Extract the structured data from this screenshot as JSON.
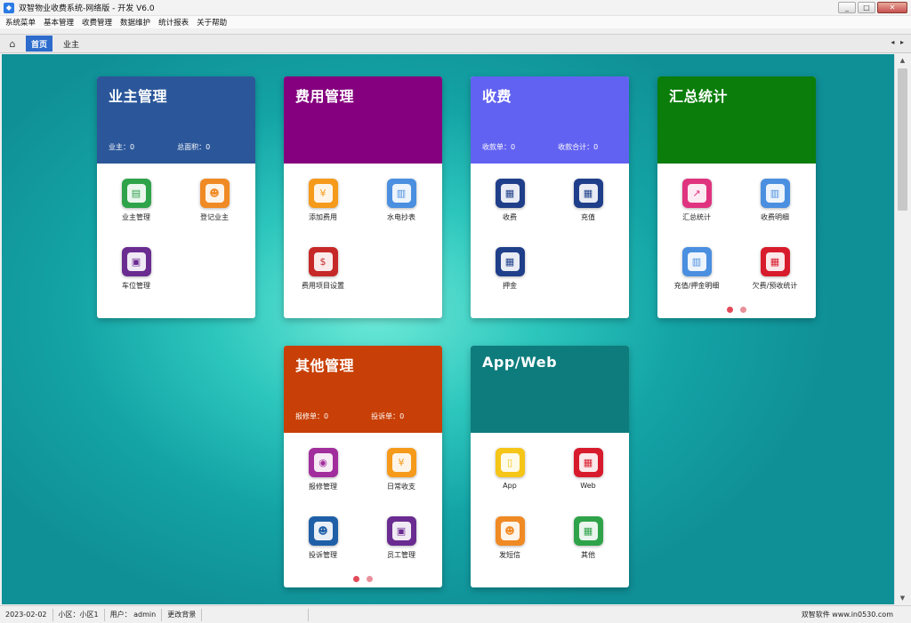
{
  "window": {
    "title": "双智物业收费系统-网络版 - 开发  V6.0",
    "minimize": "_",
    "maximize": "□",
    "close": "✕",
    "accent": "#2d6bcc"
  },
  "menu": [
    "系统菜单",
    "基本管理",
    "收费管理",
    "数据维护",
    "统计报表",
    "关于帮助"
  ],
  "tabs": {
    "home_icon": "⌂",
    "items": [
      "首页",
      "业主"
    ],
    "arrows": "◂ ▸"
  },
  "cards": {
    "owner": {
      "title": "业主管理",
      "color": "#2b579a",
      "stats": [
        "业主：0",
        "总面积：0"
      ],
      "tiles": [
        {
          "label": "业主管理",
          "icon": "owner-list-icon",
          "color": "#2fa34a",
          "glyph": "▤"
        },
        {
          "label": "登记业主",
          "icon": "register-owner-icon",
          "color": "#f08a24",
          "glyph": "☻"
        },
        {
          "label": "车位管理",
          "icon": "parking-icon",
          "color": "#6a2c91",
          "glyph": "▣"
        }
      ]
    },
    "fee": {
      "title": "费用管理",
      "color": "#85007e",
      "stats": [],
      "tiles": [
        {
          "label": "添加费用",
          "icon": "add-fee-icon",
          "color": "#f59a1b",
          "glyph": "¥"
        },
        {
          "label": "水电抄表",
          "icon": "meter-icon",
          "color": "#4a8fe0",
          "glyph": "▥"
        },
        {
          "label": "费用项目设置",
          "icon": "fee-settings-icon",
          "color": "#c62828",
          "glyph": "$"
        }
      ]
    },
    "charge": {
      "title": "收费",
      "color": "#6262f2",
      "stats": [
        "收款单：0",
        "收款合计：0"
      ],
      "tiles": [
        {
          "label": "收费",
          "icon": "charge-icon",
          "color": "#1f3f8a",
          "glyph": "▦"
        },
        {
          "label": "充值",
          "icon": "recharge-icon",
          "color": "#1f3f8a",
          "glyph": "▦"
        },
        {
          "label": "押金",
          "icon": "deposit-icon",
          "color": "#1f3f8a",
          "glyph": "▦"
        }
      ]
    },
    "summary": {
      "title": "汇总统计",
      "color": "#0a7d0a",
      "stats": [],
      "tiles": [
        {
          "label": "汇总统计",
          "icon": "summary-chart-icon",
          "color": "#e0337f",
          "glyph": "↗"
        },
        {
          "label": "收费明细",
          "icon": "charge-detail-icon",
          "color": "#4a8fe0",
          "glyph": "▥"
        },
        {
          "label": "充值/押金明细",
          "icon": "deposit-detail-icon",
          "color": "#4a8fe0",
          "glyph": "▥"
        },
        {
          "label": "欠费/预收统计",
          "icon": "arrears-icon",
          "color": "#d81b2c",
          "glyph": "▦"
        }
      ]
    },
    "other": {
      "title": "其他管理",
      "color": "#c84007",
      "stats": [
        "报修单：0",
        "投诉单：0"
      ],
      "tiles": [
        {
          "label": "报修管理",
          "icon": "repair-icon",
          "color": "#a22d9c",
          "glyph": "◉"
        },
        {
          "label": "日常收支",
          "icon": "daily-finance-icon",
          "color": "#f59a1b",
          "glyph": "¥"
        },
        {
          "label": "投诉管理",
          "icon": "complaint-icon",
          "color": "#1f5fa8",
          "glyph": "☻"
        },
        {
          "label": "员工管理",
          "icon": "staff-icon",
          "color": "#6a2c91",
          "glyph": "▣"
        }
      ]
    },
    "appweb": {
      "title": "App/Web",
      "color": "#0e7c7c",
      "stats": [],
      "tiles": [
        {
          "label": "App",
          "icon": "mobile-app-icon",
          "color": "#f5c518",
          "glyph": "▯"
        },
        {
          "label": "Web",
          "icon": "web-icon",
          "color": "#d81b2c",
          "glyph": "▦"
        },
        {
          "label": "发短信",
          "icon": "sms-icon",
          "color": "#f08a24",
          "glyph": "☻"
        },
        {
          "label": "其他",
          "icon": "other-grid-icon",
          "color": "#2fa34a",
          "glyph": "▦"
        }
      ]
    }
  },
  "status": {
    "date": "2023-02-02",
    "community": "小区：小区1",
    "user": "用户： admin",
    "background": "更改背景",
    "brand": "双智软件 www.in0530.com"
  }
}
